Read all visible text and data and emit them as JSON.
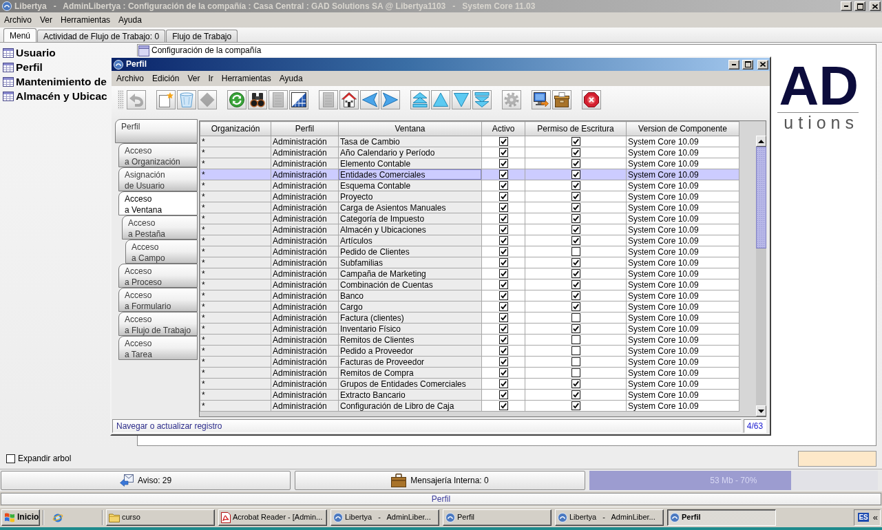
{
  "window": {
    "title": "Libertya   -   AdminLibertya : Configuración de la compañía : Casa Central : GAD Solutions SA @ Libertya1103   -   System Core 11.03",
    "active": false,
    "menu": [
      "Archivo",
      "Ver",
      "Herramientas",
      "Ayuda"
    ]
  },
  "tabs": [
    {
      "label": "Menú",
      "selected": true
    },
    {
      "label": "Actividad de Flujo de Trabajo: 0",
      "selected": false
    },
    {
      "label": "Flujo de Trabajo",
      "selected": false
    }
  ],
  "menu_tree": {
    "items": [
      "Usuario",
      "Perfil",
      "Mantenimiento de",
      "Almacén y Ubicac"
    ]
  },
  "workspace": {
    "header": "Configuración de la compañía",
    "logo": [
      "AD",
      "utions"
    ]
  },
  "profile_window": {
    "title": "Perfil",
    "active": true,
    "menu": [
      "Archivo",
      "Edición",
      "Ver",
      "Ir",
      "Herramientas",
      "Ayuda"
    ],
    "toolbar": [
      {
        "buttons": [
          {
            "kind": "undo",
            "disabled": true
          }
        ]
      },
      {
        "buttons": [
          {
            "kind": "new",
            "disabled": false
          },
          {
            "kind": "bin",
            "disabled": false
          },
          {
            "kind": "diamond",
            "disabled": true
          }
        ]
      },
      {
        "buttons": [
          {
            "kind": "refresh",
            "disabled": false
          },
          {
            "kind": "binoculars",
            "disabled": false
          },
          {
            "kind": "square",
            "disabled": true
          },
          {
            "kind": "grid",
            "disabled": false
          }
        ]
      },
      {
        "buttons": [
          {
            "kind": "square",
            "disabled": true
          },
          {
            "kind": "house",
            "disabled": false
          },
          {
            "kind": "left",
            "disabled": false
          },
          {
            "kind": "right",
            "disabled": false
          }
        ]
      },
      {
        "buttons": [
          {
            "kind": "first",
            "disabled": false
          },
          {
            "kind": "up",
            "disabled": false
          },
          {
            "kind": "down",
            "disabled": false
          },
          {
            "kind": "last",
            "disabled": false
          }
        ]
      },
      {
        "buttons": [
          {
            "kind": "gear",
            "disabled": true
          }
        ]
      },
      {
        "buttons": [
          {
            "kind": "monitor",
            "disabled": false
          },
          {
            "kind": "box",
            "disabled": false
          }
        ]
      },
      {
        "buttons": [
          {
            "kind": "stop",
            "disabled": false
          }
        ]
      }
    ],
    "side_tabs": [
      {
        "label": "Perfil",
        "selected": false,
        "children": [
          {
            "label": "Acceso\na Organización",
            "selected": false
          },
          {
            "label": "Asignación\nde Usuario",
            "selected": false
          },
          {
            "label": "Acceso\na Ventana",
            "selected": true,
            "children": [
              {
                "label": "Acceso\na Pestaña",
                "selected": false,
                "children": [
                  {
                    "label": "Acceso\na Campo",
                    "selected": false
                  }
                ]
              }
            ]
          },
          {
            "label": "Acceso\na Proceso",
            "selected": false
          },
          {
            "label": "Acceso\na Formulario",
            "selected": false
          },
          {
            "label": "Acceso\na Flujo de Trabajo",
            "selected": false
          },
          {
            "label": "Acceso\na Tarea",
            "selected": false
          }
        ]
      }
    ],
    "table": {
      "columns": [
        "Organización",
        "Perfil",
        "Ventana",
        "Activo",
        "Permiso de Escritura",
        "Version de Componente"
      ],
      "rows": [
        {
          "organization": "*",
          "profile": "Administración",
          "window": "Tasa de Cambio",
          "active": true,
          "write_access": true,
          "version": "System Core 10.09",
          "selected": false
        },
        {
          "organization": "*",
          "profile": "Administración",
          "window": "Año Calendario y Período",
          "active": true,
          "write_access": true,
          "version": "System Core 10.09",
          "selected": false
        },
        {
          "organization": "*",
          "profile": "Administración",
          "window": "Elemento Contable",
          "active": true,
          "write_access": true,
          "version": "System Core 10.09",
          "selected": false
        },
        {
          "organization": "*",
          "profile": "Administración",
          "window": "Entidades Comerciales",
          "active": true,
          "write_access": true,
          "version": "System Core 10.09",
          "selected": true
        },
        {
          "organization": "*",
          "profile": "Administración",
          "window": "Esquema Contable",
          "active": true,
          "write_access": true,
          "version": "System Core 10.09",
          "selected": false
        },
        {
          "organization": "*",
          "profile": "Administración",
          "window": "Proyecto",
          "active": true,
          "write_access": true,
          "version": "System Core 10.09",
          "selected": false
        },
        {
          "organization": "*",
          "profile": "Administración",
          "window": "Carga de Asientos Manuales",
          "active": true,
          "write_access": true,
          "version": "System Core 10.09",
          "selected": false
        },
        {
          "organization": "*",
          "profile": "Administración",
          "window": "Categoría de Impuesto",
          "active": true,
          "write_access": true,
          "version": "System Core 10.09",
          "selected": false
        },
        {
          "organization": "*",
          "profile": "Administración",
          "window": "Almacén y Ubicaciones",
          "active": true,
          "write_access": true,
          "version": "System Core 10.09",
          "selected": false
        },
        {
          "organization": "*",
          "profile": "Administración",
          "window": "Artículos",
          "active": true,
          "write_access": true,
          "version": "System Core 10.09",
          "selected": false
        },
        {
          "organization": "*",
          "profile": "Administración",
          "window": "Pedido de Clientes",
          "active": true,
          "write_access": false,
          "version": "System Core 10.09",
          "selected": false
        },
        {
          "organization": "*",
          "profile": "Administración",
          "window": "Subfamilias",
          "active": true,
          "write_access": true,
          "version": "System Core 10.09",
          "selected": false
        },
        {
          "organization": "*",
          "profile": "Administración",
          "window": "Campaña de Marketing",
          "active": true,
          "write_access": true,
          "version": "System Core 10.09",
          "selected": false
        },
        {
          "organization": "*",
          "profile": "Administración",
          "window": "Combinación de Cuentas",
          "active": true,
          "write_access": true,
          "version": "System Core 10.09",
          "selected": false
        },
        {
          "organization": "*",
          "profile": "Administración",
          "window": "Banco",
          "active": true,
          "write_access": true,
          "version": "System Core 10.09",
          "selected": false
        },
        {
          "organization": "*",
          "profile": "Administración",
          "window": "Cargo",
          "active": true,
          "write_access": true,
          "version": "System Core 10.09",
          "selected": false
        },
        {
          "organization": "*",
          "profile": "Administración",
          "window": "Factura (clientes)",
          "active": true,
          "write_access": false,
          "version": "System Core 10.09",
          "selected": false
        },
        {
          "organization": "*",
          "profile": "Administración",
          "window": "Inventario Físico",
          "active": true,
          "write_access": true,
          "version": "System Core 10.09",
          "selected": false
        },
        {
          "organization": "*",
          "profile": "Administración",
          "window": "Remitos de Clientes",
          "active": true,
          "write_access": false,
          "version": "System Core 10.09",
          "selected": false
        },
        {
          "organization": "*",
          "profile": "Administración",
          "window": "Pedido a Proveedor",
          "active": true,
          "write_access": false,
          "version": "System Core 10.09",
          "selected": false
        },
        {
          "organization": "*",
          "profile": "Administración",
          "window": "Facturas de Proveedor",
          "active": true,
          "write_access": false,
          "version": "System Core 10.09",
          "selected": false
        },
        {
          "organization": "*",
          "profile": "Administración",
          "window": "Remitos de Compra",
          "active": true,
          "write_access": false,
          "version": "System Core 10.09",
          "selected": false
        },
        {
          "organization": "*",
          "profile": "Administración",
          "window": "Grupos de Entidades Comerciales",
          "active": true,
          "write_access": true,
          "version": "System Core 10.09",
          "selected": false
        },
        {
          "organization": "*",
          "profile": "Administración",
          "window": "Extracto Bancario",
          "active": true,
          "write_access": true,
          "version": "System Core 10.09",
          "selected": false
        },
        {
          "organization": "*",
          "profile": "Administración",
          "window": "Configuración de Libro de Caja",
          "active": true,
          "write_access": true,
          "version": "System Core 10.09",
          "selected": false
        }
      ]
    },
    "status": "Navegar o actualizar registro",
    "record_count": "4/63"
  },
  "expand_tree": {
    "label": "Expandir arbol",
    "checked": false
  },
  "bottom_bar": {
    "notices": "Aviso: 29",
    "messages": "Mensajería Interna: 0",
    "memory": {
      "reading": "53 Mb - 70%",
      "level": 0.7
    }
  },
  "status_bar": "Perfil",
  "taskbar": {
    "start": "Inicio",
    "tasks": [
      {
        "kind": "folder",
        "label": "curso",
        "selected": false
      },
      {
        "kind": "pdf",
        "label": "Acrobat Reader - [Admin...",
        "selected": false
      },
      {
        "kind": "app",
        "label": "Libertya   -   AdminLiber...",
        "selected": false
      },
      {
        "kind": "app",
        "label": "Perfil",
        "selected": false
      },
      {
        "kind": "app",
        "label": "Libertya   -   AdminLiber...",
        "selected": false
      },
      {
        "kind": "app",
        "label": "Perfil",
        "selected": true
      }
    ],
    "language": "ES",
    "tray_toggle": "«"
  }
}
